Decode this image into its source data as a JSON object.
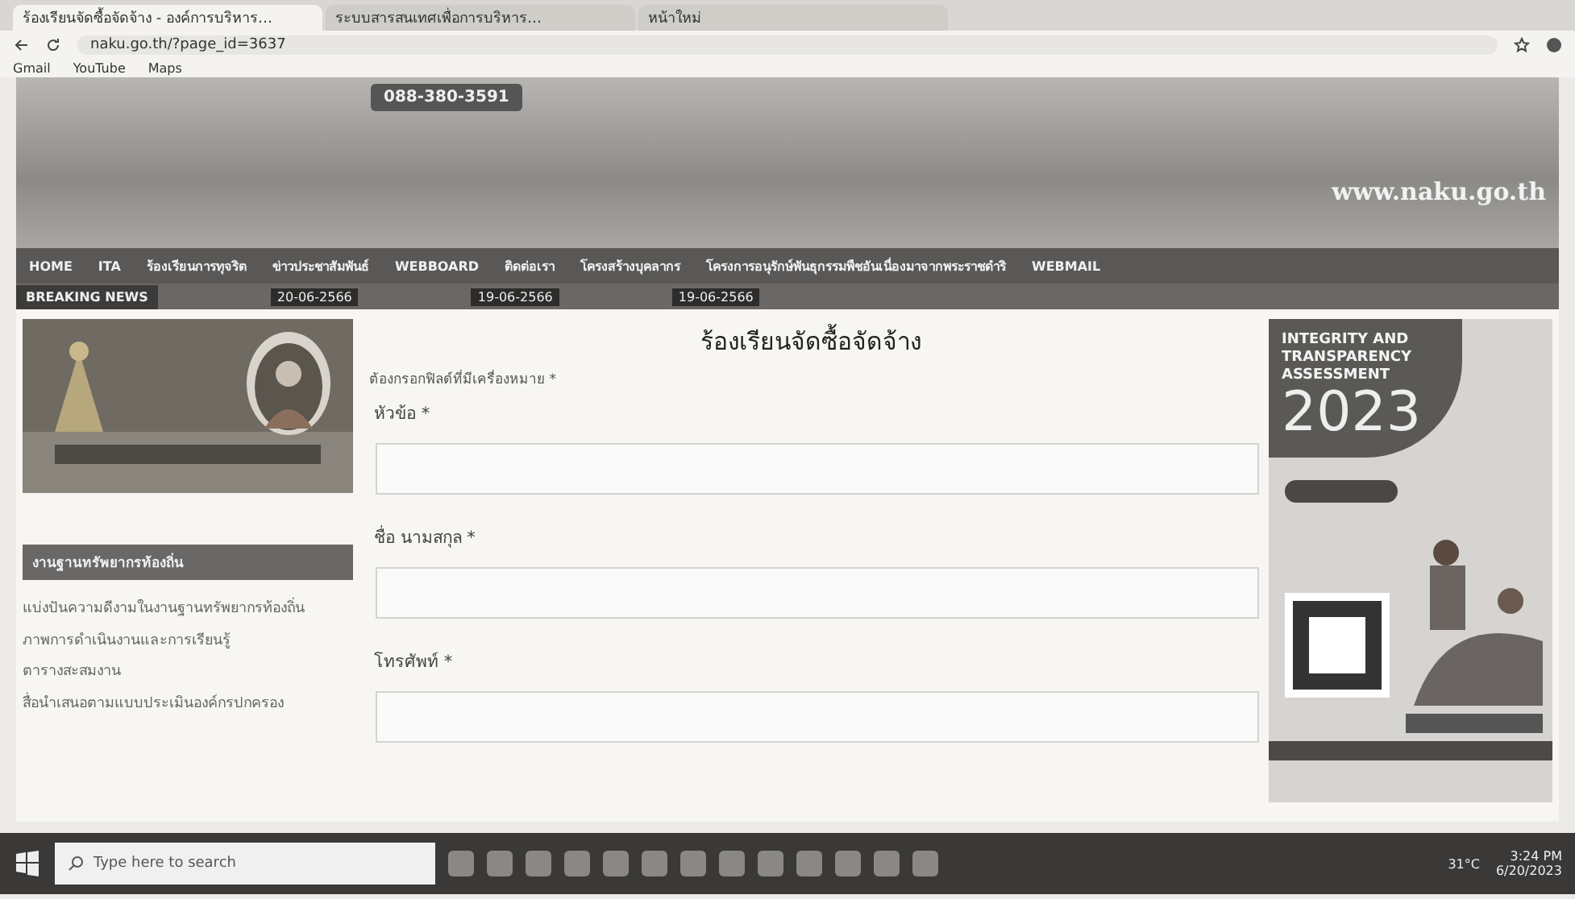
{
  "browser": {
    "tabs": [
      {
        "title": "ร้องเรียนจัดซื้อจัดจ้าง - องค์การบริหาร…",
        "selected": true
      },
      {
        "title": "ระบบสารสนเทศเพื่อการบริหาร…",
        "selected": false
      },
      {
        "title": "หน้าใหม่",
        "selected": false
      }
    ],
    "address": "naku.go.th/?page_id=3637",
    "bookmarks": [
      "Gmail",
      "YouTube",
      "Maps"
    ]
  },
  "banner": {
    "phone": "088-380-3591",
    "site": "www.naku.go.th"
  },
  "nav": [
    "HOME",
    "ITA",
    "ร้องเรียนการทุจริต",
    "ข่าวประชาสัมพันธ์",
    "WEBBOARD",
    "ติดต่อเรา",
    "โครงสร้างบุคลากร",
    "โครงการอนุรักษ์พันธุกรรมพืชอันเนื่องมาจากพระราชดำริ",
    "WEBMAIL"
  ],
  "news": {
    "label": "BREAKING NEWS",
    "dates": [
      "20-06-2566",
      "19-06-2566",
      "19-06-2566"
    ]
  },
  "sidebar": {
    "heading": "งานฐานทรัพยากรท้องถิ่น",
    "links": [
      "แบ่งปันความดีงามในงานฐานทรัพยากรท้องถิ่น",
      "ภาพการดำเนินงานและการเรียนรู้",
      "ตารางสะสมงาน",
      "สื่อนำเสนอตามแบบประเมินองค์กรปกครอง"
    ]
  },
  "form": {
    "title": "ร้องเรียนจัดซื้อจัดจ้าง",
    "note": "ต้องกรอกฟิลด์ที่มีเครื่องหมาย *",
    "fields": [
      "หัวข้อ *",
      "ชื่อ นามสกุล *",
      "โทรศัพท์ *"
    ]
  },
  "ad": {
    "heading": "INTEGRITY AND TRANSPARENCY ASSESSMENT",
    "year": "2023"
  },
  "taskbar": {
    "search_placeholder": "Type here to search",
    "weather": "31°C",
    "time": "3:24 PM",
    "date": "6/20/2023"
  }
}
